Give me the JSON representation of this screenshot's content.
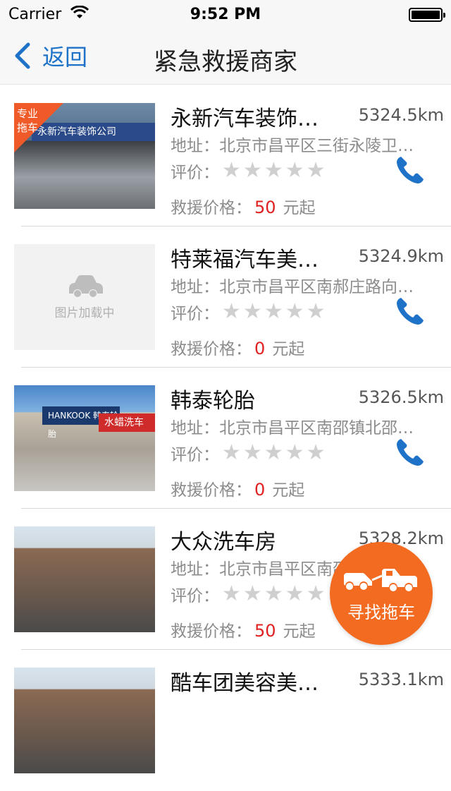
{
  "status": {
    "carrier": "Carrier",
    "time": "9:52 PM"
  },
  "nav": {
    "back_label": "返回",
    "title": "紧急救援商家"
  },
  "labels": {
    "addr_prefix": "地址：",
    "rating_prefix": "评价：",
    "price_prefix": "救援价格：",
    "price_suffix": "元起"
  },
  "merchants": [
    {
      "name": "永新汽车装饰…",
      "distance": "5324.5km",
      "address": "北京市昌平区三街永陵卫…",
      "price": "50",
      "badge": "专业\n拖车",
      "badge_line1": "专业",
      "badge_line2": "拖车",
      "sign": "永新汽车装饰公司",
      "rating": 0
    },
    {
      "name": "特莱福汽车美…",
      "distance": "5324.9km",
      "address": "北京市昌平区南郝庄路向…",
      "price": "0",
      "placeholder_text": "图片加载中",
      "rating": 0
    },
    {
      "name": "韩泰轮胎",
      "distance": "5326.5km",
      "address": "北京市昌平区南邵镇北邵…",
      "price": "0",
      "sign": "HANKOOK 韩泰轮胎",
      "sign2": "水蜡洗车",
      "rating": 0
    },
    {
      "name": "大众洗车房",
      "distance": "5328.2km",
      "address": "北京市昌平区南邵镇地铁…",
      "price": "50",
      "rating": 0
    },
    {
      "name": "酷车团美容美…",
      "distance": "5333.1km"
    }
  ],
  "fab": {
    "label": "寻找拖车"
  },
  "colors": {
    "accent": "#1e73c8",
    "price": "#e02020",
    "fab": "#f36b21",
    "badge": "#f05a28"
  },
  "icons": {
    "back": "chevron-left-icon",
    "phone": "phone-icon",
    "star": "star-icon",
    "wifi": "wifi-icon",
    "battery": "battery-icon",
    "car": "car-icon",
    "tow_truck": "tow-truck-icon"
  }
}
